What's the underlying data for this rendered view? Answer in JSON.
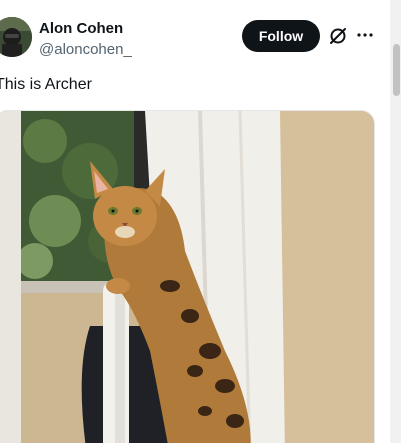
{
  "tweet": {
    "author_name": "Alon Cohen",
    "author_handle": "@aloncohen_",
    "follow_label": "Follow",
    "text": "This is Archer",
    "icons": {
      "avatar": "avatar",
      "grok": "grok-icon",
      "more": "more-icon"
    }
  },
  "colors": {
    "follow_bg": "#0f1419",
    "name": "#0f1419",
    "handle": "#536471"
  }
}
